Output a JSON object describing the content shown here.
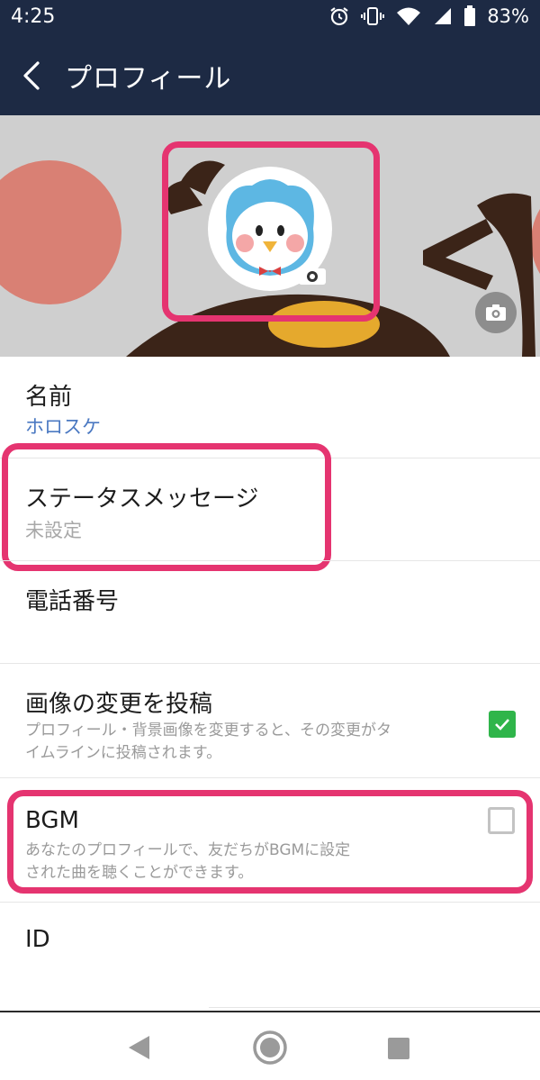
{
  "status_bar": {
    "time": "4:25",
    "battery_percent": "83%",
    "icons": [
      "alarm-icon",
      "vibrate-icon",
      "wifi-icon",
      "signal-icon",
      "battery-icon"
    ]
  },
  "app_bar": {
    "back_icon": "chevron-left-icon",
    "title": "プロフィール"
  },
  "colors": {
    "header_bg": "#1d2a44",
    "highlight_border": "#e53470",
    "link_blue": "#4b79c2",
    "check_green": "#2fb54a"
  },
  "profile": {
    "name_label": "名前",
    "name_value": "ホロスケ",
    "status_label": "ステータスメッセージ",
    "status_value": "未設定",
    "phone_label": "電話番号",
    "post_image_change": {
      "label": "画像の変更を投稿",
      "description_line1": "プロフィール・背景画像を変更すると、その変更がタ",
      "description_line2": "イムラインに投稿されます。",
      "checked": true
    },
    "bgm": {
      "label": "BGM",
      "description_line1": "あなたのプロフィールで、友だちがBGMに設定",
      "description_line2": "された曲を聴くことができます。",
      "checked": false
    },
    "id_label": "ID"
  },
  "nav_bar": {
    "buttons": [
      "back-triangle-icon",
      "home-circle-icon",
      "recents-square-icon"
    ]
  }
}
